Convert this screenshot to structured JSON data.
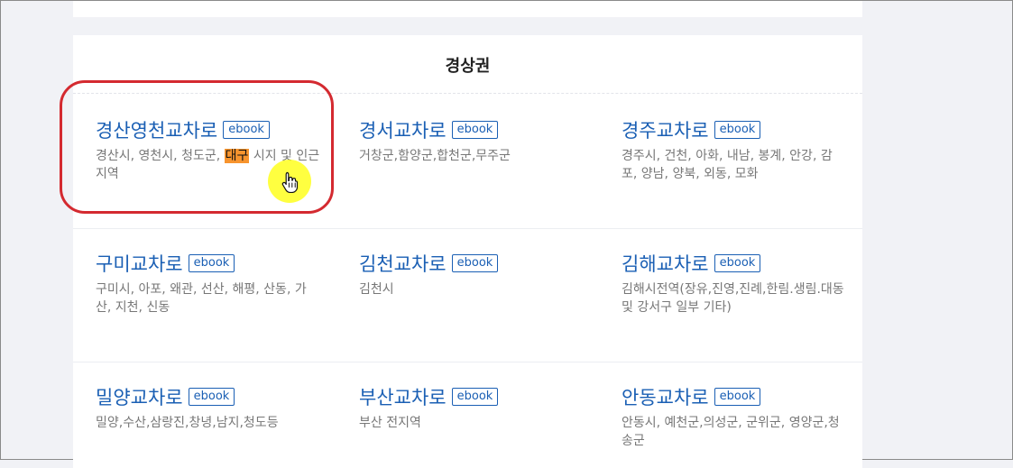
{
  "region": {
    "title": "경상권"
  },
  "ebook_label": "ebook",
  "items": [
    {
      "name": "경산영천교차로",
      "desc_before": "경산시, 영천시, 청도군, ",
      "desc_highlight": "대구",
      "desc_after": " 시지 및 인근 지역"
    },
    {
      "name": "경서교차로",
      "desc": "거창군,함양군,합천군,무주군"
    },
    {
      "name": "경주교차로",
      "desc": "경주시, 건천, 아화, 내남, 봉계, 안강, 감포, 양남, 양북, 외동, 모화"
    },
    {
      "name": "구미교차로",
      "desc": "구미시, 아포, 왜관, 선산, 해평, 산동, 가산, 지천, 신동"
    },
    {
      "name": "김천교차로",
      "desc": "김천시"
    },
    {
      "name": "김해교차로",
      "desc": "김해시전역(장유,진영,진례,한림.생림.대동 및 강서구 일부 기타)"
    },
    {
      "name": "밀양교차로",
      "desc": "밀양,수산,삼랑진,창녕,남지,청도등"
    },
    {
      "name": "부산교차로",
      "desc": "부산 전지역"
    },
    {
      "name": "안동교차로",
      "desc": "안동시, 예천군,의성군, 군위군, 영양군,청송군"
    }
  ],
  "colors": {
    "link": "#1a5fb4",
    "highlight": "#f7942e",
    "annotation": "#d42a30",
    "cursor_halo": "#ffff00"
  },
  "icons": {
    "cursor": "hand-pointer-icon"
  }
}
